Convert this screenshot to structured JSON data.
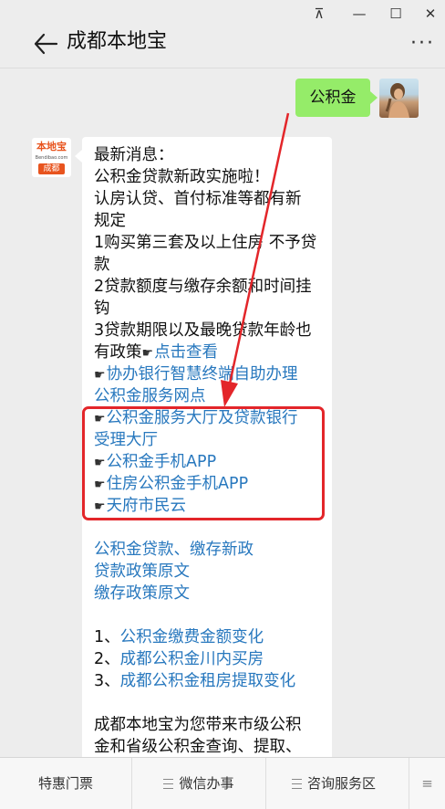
{
  "window": {
    "pin": "⊼",
    "minimize": "—",
    "maximize": "☐",
    "close": "✕"
  },
  "header": {
    "title": "成都本地宝",
    "more": "···"
  },
  "user_message": "公积金",
  "bot_avatar": {
    "logo_text": "本地宝",
    "domain_text": "Bendibao.com",
    "city_text": "成都"
  },
  "bot_message": {
    "intro": [
      "最新消息：",
      "公积金贷款新政实施啦！",
      "认房认贷、首付标准等都有新",
      "规定",
      "1购买第三套及以上住房 不予贷",
      "款",
      "2贷款额度与缴存余额和时间挂",
      "钩",
      "3贷款期限以及最晚贷款年龄也"
    ],
    "policy_prefix": "有政策",
    "policy_link": "点击查看",
    "hand": "☛",
    "links_a": [
      "协办银行智慧终端自助办理",
      "公积金服务网点"
    ],
    "links_boxed": [
      "公积金服务大厅及贷款银行",
      "受理大厅"
    ],
    "links_b": [
      "公积金手机APP",
      "住房公积金手机APP",
      "天府市民云"
    ],
    "policy_links": [
      "公积金贷款、缴存新政",
      "贷款政策原文",
      "缴存政策原文"
    ],
    "numbered": [
      {
        "num": "1、",
        "text": "公积金缴费金额变化"
      },
      {
        "num": "2、",
        "text": "成都公积金川内买房"
      },
      {
        "num": "3、",
        "text": "成都公积金租房提取变化"
      }
    ],
    "outro": [
      "成都本地宝为您带来市级公积",
      "金和省级公积金查询、提取、"
    ]
  },
  "tabbar": {
    "tab1": "特惠门票",
    "tab2": "微信办事",
    "tab3": "咨询服务区",
    "tab4": "≡"
  },
  "colors": {
    "link": "#2878be",
    "user_bubble": "#95ec69",
    "annotation": "#e3262a"
  }
}
